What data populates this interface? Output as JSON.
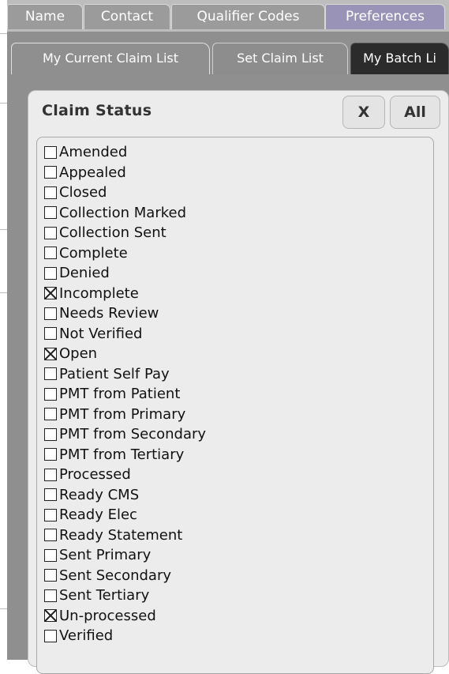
{
  "top_tabs": [
    {
      "label": "Name",
      "active": false
    },
    {
      "label": "Contact",
      "active": false
    },
    {
      "label": "Qualifier Codes",
      "active": false
    },
    {
      "label": "Preferences",
      "active": true
    }
  ],
  "sub_tabs": [
    {
      "label": "My Current Claim List",
      "active": true
    },
    {
      "label": "Set Claim List",
      "active": false
    },
    {
      "label": "My Batch Li",
      "active": false
    }
  ],
  "panel": {
    "title": "Claim Status",
    "clear_label": "X",
    "all_label": "All"
  },
  "statuses": [
    {
      "label": "Amended",
      "checked": false
    },
    {
      "label": "Appealed",
      "checked": false
    },
    {
      "label": "Closed",
      "checked": false
    },
    {
      "label": "Collection Marked",
      "checked": false
    },
    {
      "label": "Collection Sent",
      "checked": false
    },
    {
      "label": "Complete",
      "checked": false
    },
    {
      "label": "Denied",
      "checked": false
    },
    {
      "label": "Incomplete",
      "checked": true
    },
    {
      "label": "Needs Review",
      "checked": false
    },
    {
      "label": "Not Verified",
      "checked": false
    },
    {
      "label": "Open",
      "checked": true
    },
    {
      "label": "Patient Self Pay",
      "checked": false
    },
    {
      "label": "PMT from Patient",
      "checked": false
    },
    {
      "label": "PMT from Primary",
      "checked": false
    },
    {
      "label": "PMT from Secondary",
      "checked": false
    },
    {
      "label": "PMT from Tertiary",
      "checked": false
    },
    {
      "label": "Processed",
      "checked": false
    },
    {
      "label": "Ready CMS",
      "checked": false
    },
    {
      "label": "Ready Elec",
      "checked": false
    },
    {
      "label": "Ready Statement",
      "checked": false
    },
    {
      "label": "Sent Primary",
      "checked": false
    },
    {
      "label": "Sent Secondary",
      "checked": false
    },
    {
      "label": "Sent Tertiary",
      "checked": false
    },
    {
      "label": "Un-processed",
      "checked": true
    },
    {
      "label": "Verified",
      "checked": false
    }
  ]
}
